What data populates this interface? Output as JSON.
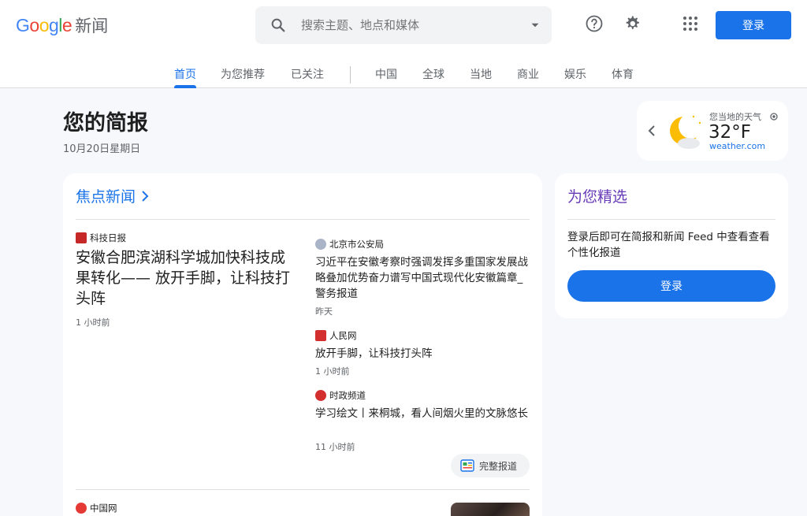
{
  "header": {
    "logo_text": [
      "G",
      "o",
      "o",
      "g",
      "l",
      "e"
    ],
    "logo_suffix": "新闻",
    "search_placeholder": "搜索主题、地点和媒体",
    "signin_label": "登录"
  },
  "tabs": [
    {
      "label": "首页",
      "active": true
    },
    {
      "label": "为您推荐"
    },
    {
      "label": "已关注"
    },
    {
      "label": "中国"
    },
    {
      "label": "全球"
    },
    {
      "label": "当地"
    },
    {
      "label": "商业"
    },
    {
      "label": "娱乐"
    },
    {
      "label": "体育"
    }
  ],
  "briefing": {
    "title": "您的简报",
    "date": "10月20日星期日"
  },
  "weather": {
    "label": "您当地的天气",
    "temp": "32°F",
    "source": "weather.com"
  },
  "headlines": {
    "title": "焦点新闻",
    "lead": {
      "source": "科技日报",
      "headline": "安徽合肥滨湖科学城加快科技成果转化—— 放开手脚，让科技打头阵",
      "time": "1 小时前"
    },
    "related": [
      {
        "source": "北京市公安局",
        "headline": "习近平在安徽考察时强调发挥多重国家发展战略叠加优势奋力谱写中国式现代化安徽篇章_警务报道",
        "time": "昨天"
      },
      {
        "source": "人民网",
        "headline": "放开手脚，让科技打头阵",
        "time": "1 小时前"
      },
      {
        "source": "时政频道",
        "headline": "学习绘文丨来桐城，看人间烟火里的文脉悠长",
        "time": "11 小时前"
      }
    ],
    "full_coverage": "完整报道",
    "next_source": "中国网"
  },
  "for_you": {
    "title": "为您精选",
    "text": "登录后即可在简报和新闻 Feed 中查看查看个性化报道",
    "button": "登录"
  },
  "colors": {
    "accent": "#1a73e8",
    "for_you_title": "#673ab7",
    "background": "#f6f8fc"
  },
  "icons": {
    "search": "search-icon",
    "help": "help-icon",
    "settings": "gear-icon",
    "apps": "apps-grid-icon",
    "weather": "moon-cloud-icon"
  }
}
